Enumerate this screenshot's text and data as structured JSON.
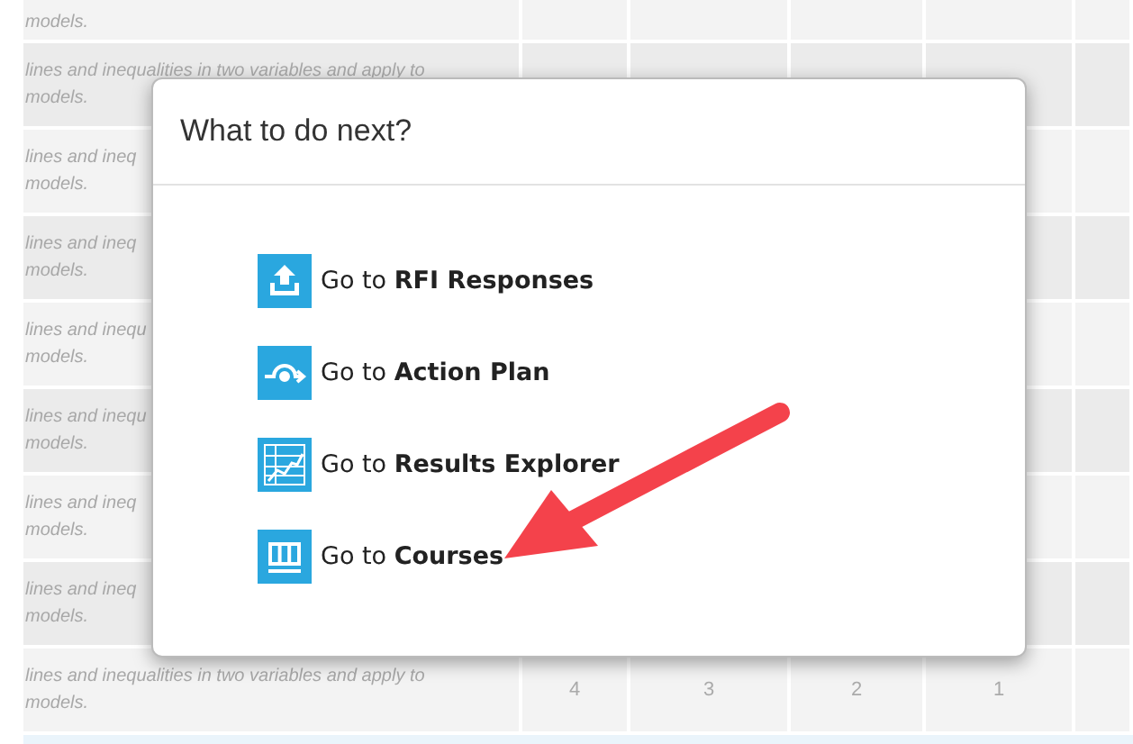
{
  "table": {
    "rows": [
      {
        "lines": [
          "models."
        ]
      },
      {
        "lines": [
          "lines and inequalities in two variables and apply to",
          "models."
        ]
      },
      {
        "lines": [
          "lines and ineq",
          "models."
        ]
      },
      {
        "lines": [
          "lines and ineq",
          "models."
        ]
      },
      {
        "lines": [
          "lines and inequ",
          "models."
        ]
      },
      {
        "lines": [
          "lines and inequ",
          "models."
        ]
      },
      {
        "lines": [
          "lines and ineq",
          "models."
        ]
      },
      {
        "lines": [
          "lines and ineq",
          "models."
        ]
      },
      {
        "lines": [
          "lines and inequalities in two variables and apply to",
          "models."
        ],
        "cells": [
          "4",
          "3",
          "2",
          "1"
        ]
      }
    ]
  },
  "dialog": {
    "title": "What to do next?",
    "options": [
      {
        "kind": "upload",
        "label": "Go to **RFI Responses**"
      },
      {
        "kind": "plan",
        "label": "Go to **Action Plan**"
      },
      {
        "kind": "chart",
        "label": "Go to **Results Explorer**"
      },
      {
        "kind": "columns",
        "label": "Go to **Courses**"
      }
    ]
  }
}
